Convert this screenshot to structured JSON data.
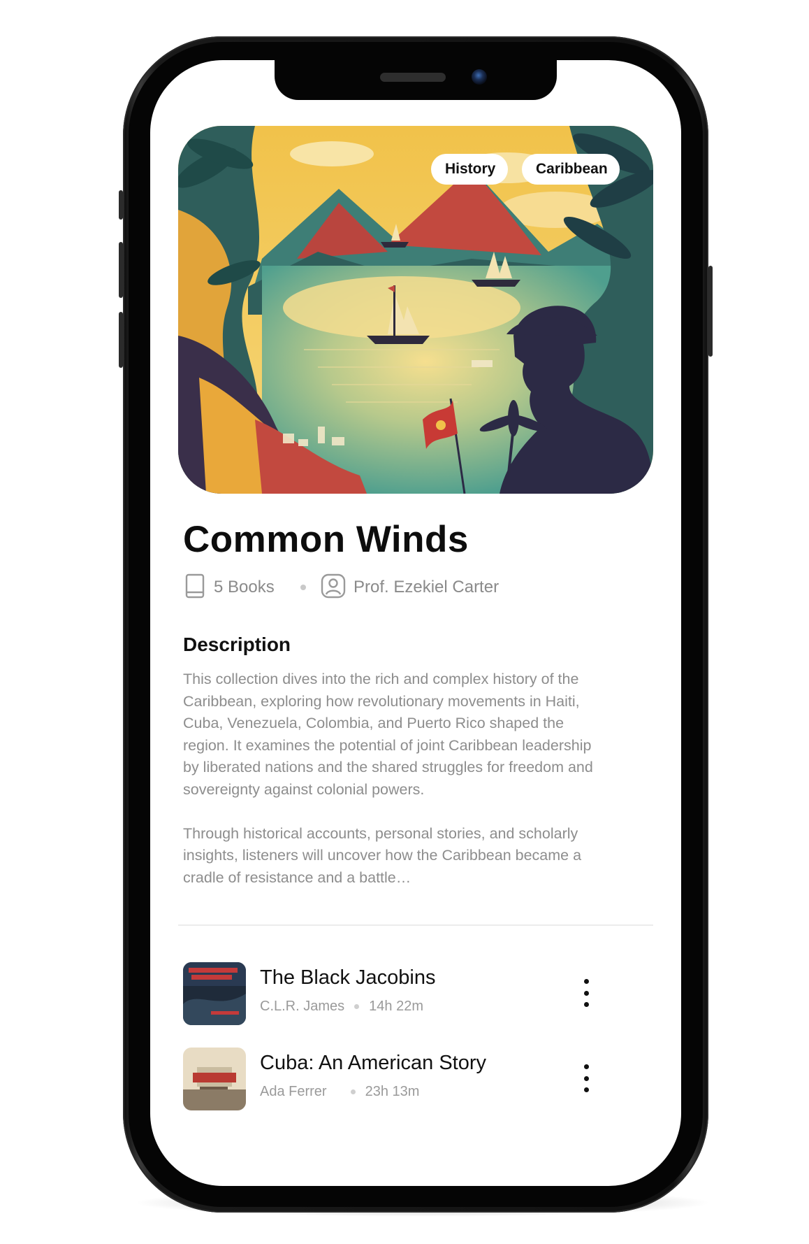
{
  "collection": {
    "tags": [
      "History",
      "Caribbean"
    ],
    "title": "Common Winds",
    "books_count": "5 Books",
    "author": "Prof. Ezekiel Carter",
    "description_heading": "Description",
    "description_paragraphs": [
      "This collection dives into the rich and complex history of the Caribbean, exploring how revolutionary movements in Haiti, Cuba, Venezuela, Colombia, and Puerto Rico shaped the region. It examines the potential of joint Caribbean leadership by liberated nations and the shared struggles for freedom and sovereignty against colonial powers.",
      "Through historical accounts, personal stories, and scholarly insights, listeners will uncover how the Caribbean became a cradle of resistance and a battle…"
    ]
  },
  "books": [
    {
      "title": "The Black Jacobins",
      "author": "C.L.R. James",
      "duration": "14h 22m"
    },
    {
      "title": "Cuba: An American Story",
      "author": "Ada Ferrer",
      "duration": "23h 13m"
    }
  ],
  "icons": {
    "books": "book-icon",
    "author": "user-icon",
    "more": "kebab-menu-icon"
  },
  "colors": {
    "text_primary": "#0d0d0d",
    "text_secondary": "#8d8d8d",
    "tag_background": "#ffffff",
    "screen_background": "#ffffff"
  }
}
